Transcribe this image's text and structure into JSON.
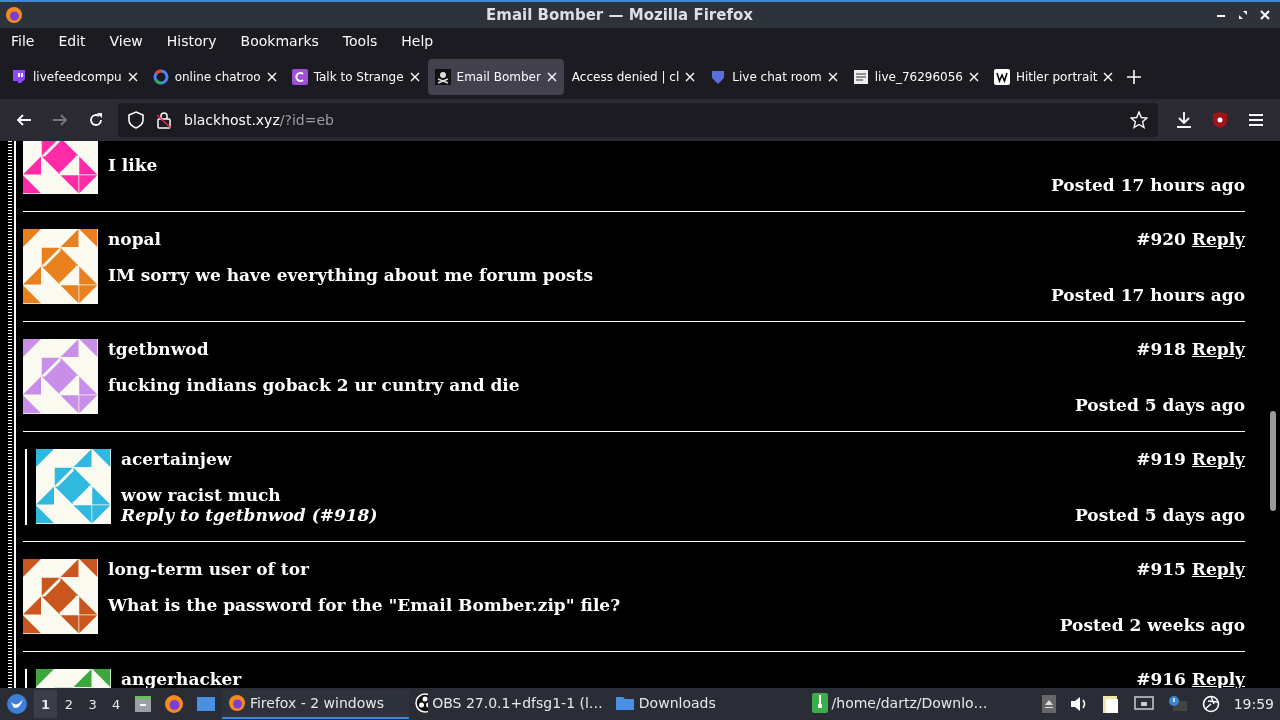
{
  "window": {
    "title": "Email Bomber — Mozilla Firefox"
  },
  "menu": [
    "File",
    "Edit",
    "View",
    "History",
    "Bookmarks",
    "Tools",
    "Help"
  ],
  "tabs": [
    {
      "label": "livefeedcompu",
      "kind": "chat",
      "selected": false
    },
    {
      "label": "online chatroo",
      "kind": "ring",
      "selected": false
    },
    {
      "label": "Talk to Strange",
      "kind": "square",
      "selected": false
    },
    {
      "label": "Email Bomber",
      "kind": "flag",
      "selected": true
    },
    {
      "label": "Access denied | cl",
      "kind": "none",
      "selected": false
    },
    {
      "label": "Live chat room",
      "kind": "shield",
      "selected": false
    },
    {
      "label": "live_76296056",
      "kind": "file",
      "selected": false
    },
    {
      "label": "Hitler portrait",
      "kind": "page",
      "selected": false
    }
  ],
  "address": {
    "host": "blackhost.xyz",
    "path": "/?id=eb"
  },
  "posts": [
    {
      "kind": "post",
      "color": "#ff2aa8",
      "text": "I like",
      "posted": "Posted 17 hours ago"
    },
    {
      "kind": "post",
      "color": "#e8801e",
      "user": "nopal",
      "number": "#920",
      "reply": "Reply",
      "text": "IM sorry we have everything about me forum posts",
      "posted": "Posted 17 hours ago"
    },
    {
      "kind": "post",
      "color": "#c98ee8",
      "user": "tgetbnwod",
      "number": "#918",
      "reply": "Reply",
      "text": "fucking indians goback 2 ur cuntry and die",
      "posted": "Posted 5 days ago"
    },
    {
      "kind": "reply",
      "color": "#2fb8e0",
      "user": "acertainjew",
      "number": "#919",
      "reply": "Reply",
      "text": "wow racist much",
      "reply_to": "Reply to tgetbnwod (#918)",
      "posted": "Posted 5 days ago"
    },
    {
      "kind": "post",
      "color": "#c8561e",
      "user": "long-term user of tor",
      "number": "#915",
      "reply": "Reply",
      "text": "What is the password for the \"Email Bomber.zip\" file?",
      "posted": "Posted 2 weeks ago"
    },
    {
      "kind": "reply",
      "color": "#3aa83a",
      "user": "angerhacker",
      "number": "#916",
      "reply": "Reply"
    }
  ],
  "taskbar": {
    "workspaces": [
      {
        "label": "1",
        "selected": true
      },
      {
        "label": "2",
        "selected": false
      },
      {
        "label": "3",
        "selected": false
      },
      {
        "label": "4",
        "selected": false
      }
    ],
    "tasks": [
      {
        "label": "Firefox - 2 windows",
        "kind": "browser",
        "selected": true
      },
      {
        "label": "OBS 27.0.1+dfsg1-1 (l…",
        "kind": "record",
        "selected": false
      },
      {
        "label": "Downloads",
        "kind": "folder",
        "selected": false
      },
      {
        "label": "/home/dartz/Downlo…",
        "kind": "archive",
        "selected": false
      }
    ],
    "clock": "19:59"
  }
}
